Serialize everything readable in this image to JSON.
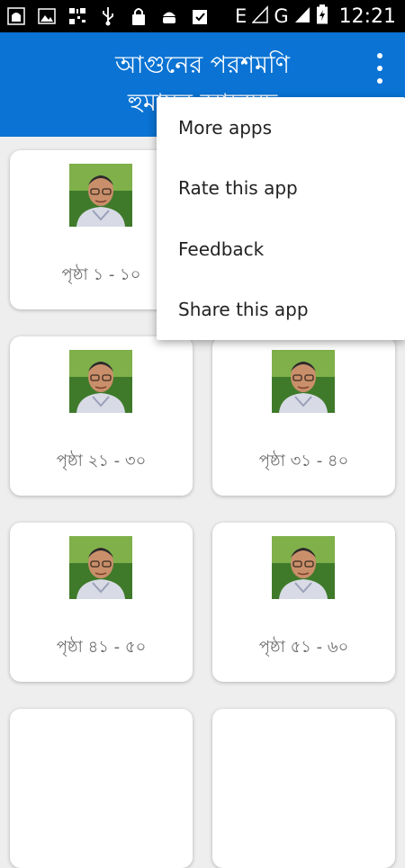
{
  "status_bar": {
    "left_icons": [
      "mosque-icon",
      "image-icon",
      "qr-icon",
      "usb-icon",
      "lock-icon",
      "android-icon",
      "clipboard-check-icon"
    ],
    "network_e": "E",
    "network_g": "G",
    "time": "12:21"
  },
  "app_bar": {
    "title_line1": "আগুনের পরশমণি",
    "title_line2": "হুমায়ূন আহমেদ"
  },
  "menu": {
    "items": [
      {
        "label": "More apps"
      },
      {
        "label": "Rate this app"
      },
      {
        "label": "Feedback"
      },
      {
        "label": "Share this app"
      }
    ]
  },
  "cards": [
    {
      "label": "পৃষ্ঠা ১ - ১০"
    },
    {
      "label": ""
    },
    {
      "label": "পৃষ্ঠা ২১ - ৩০"
    },
    {
      "label": "পৃষ্ঠা ৩১ - ৪০"
    },
    {
      "label": "পৃষ্ঠা ৪১ - ৫০"
    },
    {
      "label": "পৃষ্ঠা ৫১ - ৬০"
    }
  ],
  "colors": {
    "app_bar": "#0a73d4",
    "background": "#eeeeee",
    "card": "#ffffff",
    "status_bar": "#000000"
  }
}
